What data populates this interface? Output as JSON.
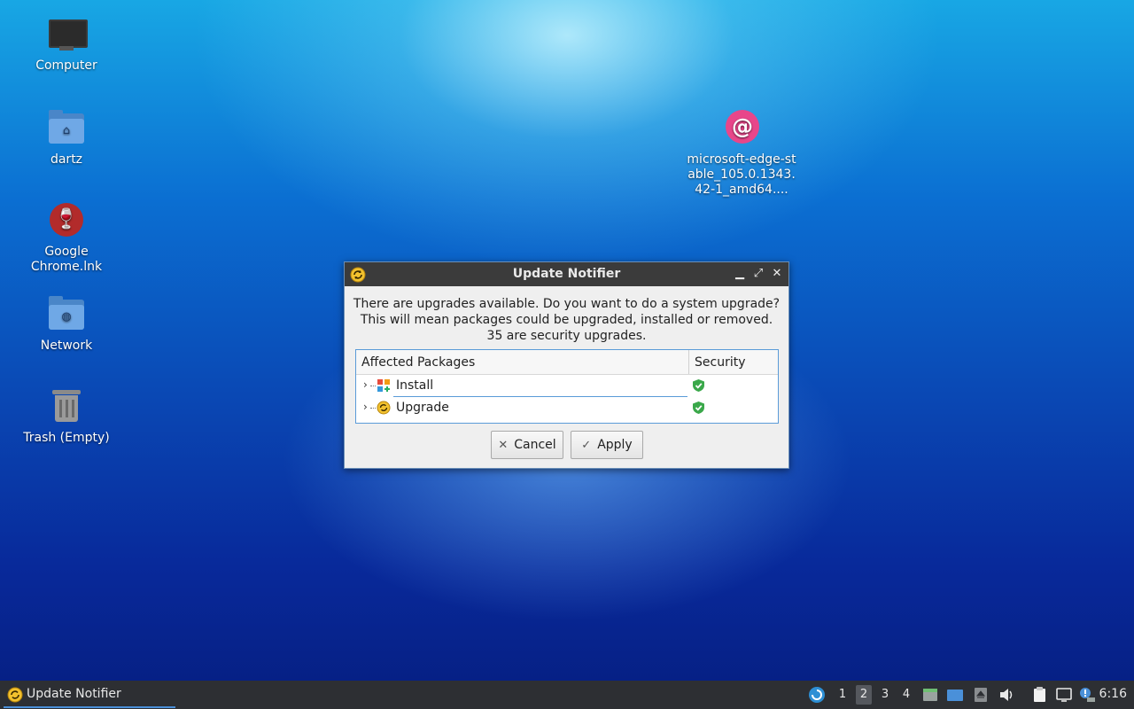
{
  "desktop": {
    "icons": [
      {
        "label": "Computer"
      },
      {
        "label": "dartz"
      },
      {
        "label": "Google Chrome.lnk"
      },
      {
        "label": "Network"
      },
      {
        "label": "Trash (Empty)"
      },
      {
        "label": "microsoft-edge-stable_105.0.1343.42-1_amd64...."
      }
    ]
  },
  "dialog": {
    "title": "Update Notifier",
    "message_line1": "There are upgrades available. Do you want to do a system upgrade?",
    "message_line2": "This will mean packages could be upgraded, installed or removed.",
    "message_line3": "35 are security upgrades.",
    "table": {
      "headers": [
        "Affected Packages",
        "Security"
      ],
      "rows": [
        {
          "label": "Install"
        },
        {
          "label": "Upgrade"
        }
      ]
    },
    "cancel_label": "Cancel",
    "apply_label": "Apply"
  },
  "taskbar": {
    "task_label": "Update Notifier",
    "workspaces": [
      "1",
      "2",
      "3",
      "4"
    ],
    "clock": "6:16"
  },
  "colors": {
    "accent": "#4a90d9",
    "update_icon": "#f2c12e",
    "shield": "#3aa84a"
  }
}
